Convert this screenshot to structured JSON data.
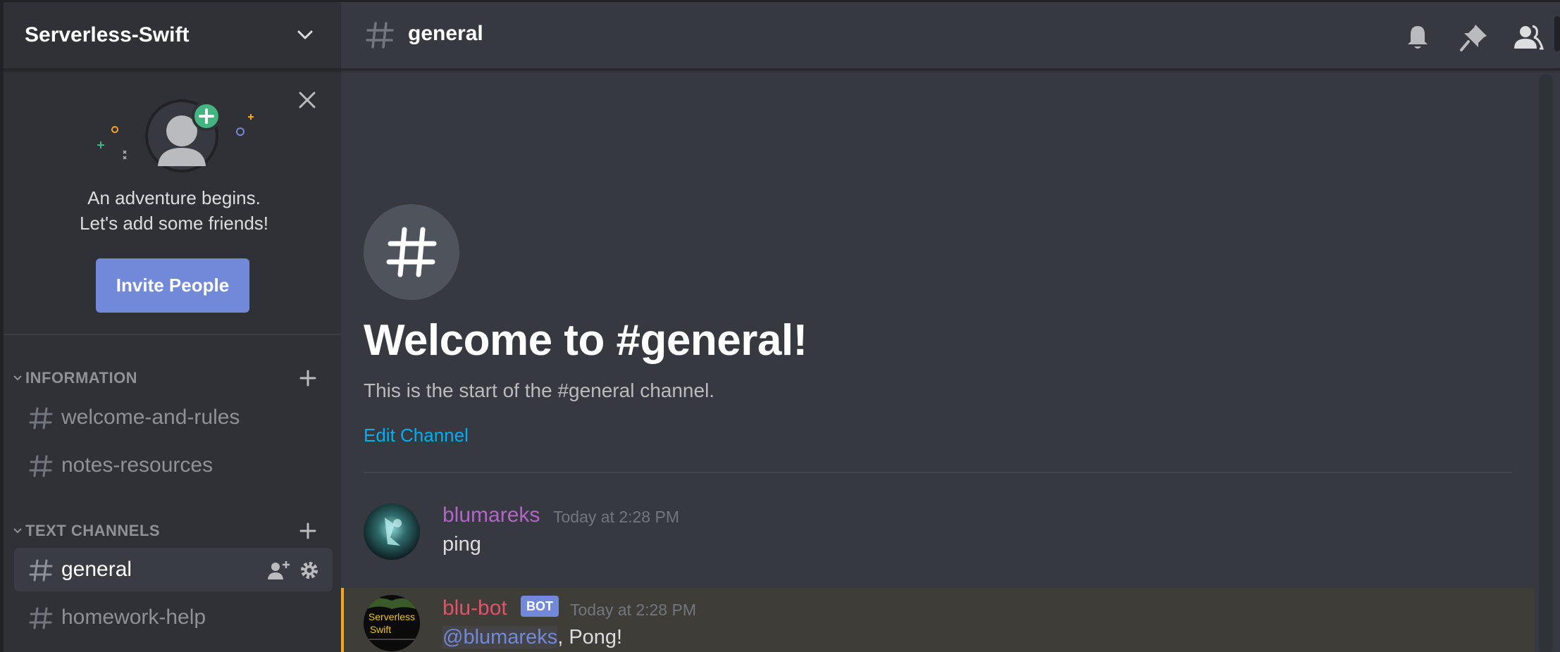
{
  "server": {
    "name": "Serverless-Swift"
  },
  "invite_card": {
    "line1": "An adventure begins.",
    "line2": "Let's add some friends!",
    "button_label": "Invite People"
  },
  "categories": [
    {
      "label": "INFORMATION",
      "channels": [
        "welcome-and-rules",
        "notes-resources"
      ]
    },
    {
      "label": "TEXT CHANNELS",
      "channels": [
        "general",
        "homework-help"
      ]
    }
  ],
  "active_channel": "general",
  "topbar": {
    "channel_name": "general",
    "icons": [
      "bell-icon",
      "pin-icon",
      "members-icon"
    ]
  },
  "welcome": {
    "title": "Welcome to #general!",
    "subtitle": "This is the start of the #general channel.",
    "edit_link": "Edit Channel"
  },
  "messages": [
    {
      "author": "blumareks",
      "author_color": "#b266c7",
      "time": "Today at 2:28 PM",
      "content": "ping",
      "bot": false
    },
    {
      "author": "blu-bot",
      "author_color": "#e0546b",
      "bot_tag": "BOT",
      "time": "Today at 2:28 PM",
      "mention": "@blumareks",
      "content": ", Pong!",
      "bot": true,
      "avatar_text_line1": "Serverless",
      "avatar_text_line2": "Swift"
    }
  ],
  "colors": {
    "accent": "#7289da",
    "link": "#00b0f4",
    "sidebar_bg": "#2f3136",
    "main_bg": "#36393f",
    "mention_highlight": "#faa61a"
  }
}
